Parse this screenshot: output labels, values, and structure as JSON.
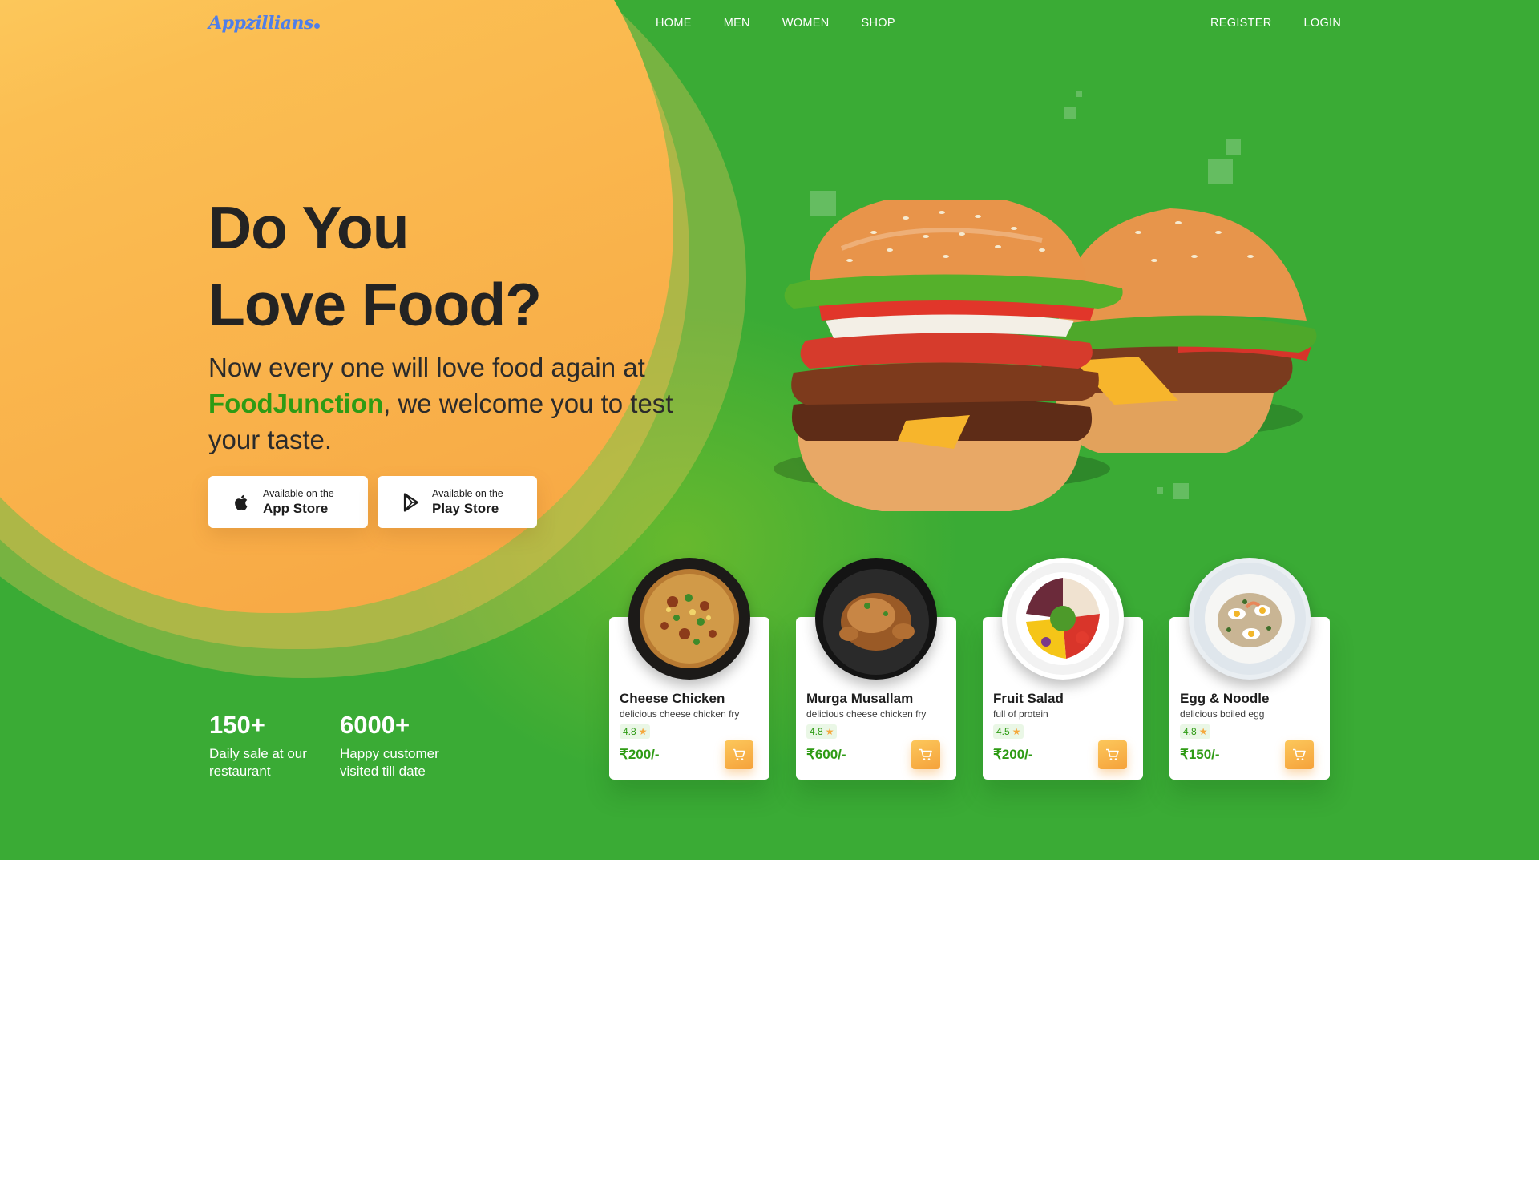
{
  "brand": {
    "logo_text": "Appzillians"
  },
  "nav": {
    "main": [
      "HOME",
      "MEN",
      "WOMEN",
      "SHOP"
    ],
    "auth": [
      "REGISTER",
      "LOGIN"
    ]
  },
  "hero": {
    "headline_line1": "Do You",
    "headline_line2": "Love Food?",
    "subtitle_before": "Now every one will love food again at",
    "subtitle_brand": "FoodJunction",
    "subtitle_after": ", we welcome you to test your taste."
  },
  "store_buttons": {
    "app_store": {
      "small": "Available on the",
      "big": "App Store",
      "icon": "apple-icon"
    },
    "play_store": {
      "small": "Available on the",
      "big": "Play Store",
      "icon": "play-store-icon"
    }
  },
  "stats": [
    {
      "value": "150+",
      "label": "Daily sale at our restaurant"
    },
    {
      "value": "6000+",
      "label": "Happy customer visited till date"
    }
  ],
  "dishes": [
    {
      "name": "Cheese Chicken",
      "desc": "delicious cheese chicken fry",
      "rating": "4.8",
      "price": "₹200/-"
    },
    {
      "name": "Murga Musallam",
      "desc": "delicious cheese chicken fry",
      "rating": "4.8",
      "price": "₹600/-"
    },
    {
      "name": "Fruit Salad",
      "desc": "full of protein",
      "rating": "4.5",
      "price": "₹200/-"
    },
    {
      "name": "Egg & Noodle",
      "desc": "delicious boiled egg",
      "rating": "4.8",
      "price": "₹150/-"
    }
  ],
  "colors": {
    "hero_green": "#3aab35",
    "accent_orange": "#f7a543",
    "brand_green": "#2e9b14",
    "logo_blue": "#4f7ee8",
    "star": "#f5a83d"
  }
}
